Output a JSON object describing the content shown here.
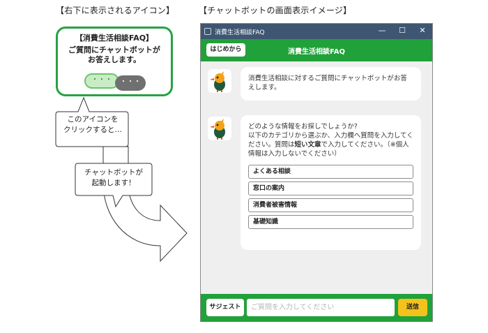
{
  "captions": {
    "left": "【右下に表示されるアイコン】",
    "right": "【チャットボットの画面表示イメージ】"
  },
  "icon_card": {
    "title": "【消費生活相談FAQ】",
    "line1": "ご質問にチャットボットが",
    "line2": "お答えします。",
    "green_bubble": "・・・",
    "gray_bubble": "・・・"
  },
  "notes": {
    "note1_line1": "このアイコンを",
    "note1_line2": "クリックすると…",
    "note2_line1": "チャットボットが",
    "note2_line2": "起動します！"
  },
  "window": {
    "title": "消費生活相談FAQ",
    "controls": {
      "minimize": "—",
      "maximize": "☐",
      "close": "✕"
    },
    "start_button": "はじめから",
    "header_title": "消費生活相談FAQ"
  },
  "messages": {
    "m1": "消費生活相談に対するご質問にチャットボットがお答えします。",
    "m2_line1": "どのような情報をお探しでしょうか?",
    "m2_pre": "以下のカテゴリから選ぶか、入力欄へ質問を入力してください。質問は",
    "m2_bold": "短い文章",
    "m2_post": "で入力してください。（※個人情報は入力しないでください）"
  },
  "categories": [
    "よくある相談",
    "窓口の案内",
    "消費者被害情報",
    "基礎知識"
  ],
  "bottom": {
    "suggest_button": "サジェスト",
    "input_placeholder": "ご質問を入力してください",
    "send_button": "送信"
  },
  "colors": {
    "brand_green": "#21a13a",
    "titlebar": "#3e5672",
    "send_yellow": "#f3c21c"
  },
  "icons": {
    "avatar": "bird-mascot-icon",
    "window_app": "app-window-icon"
  }
}
